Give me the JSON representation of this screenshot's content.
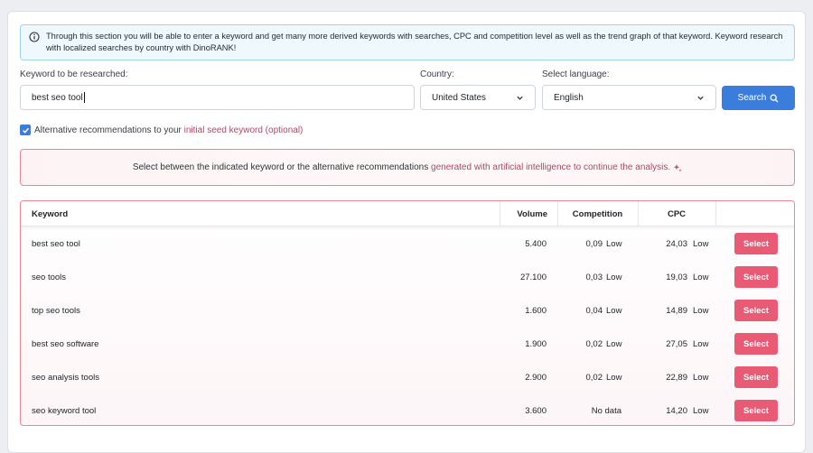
{
  "info": {
    "text": "Through this section you will be able to enter a keyword and get many more derived keywords with searches, CPC and competition level as well as the trend graph of that keyword. Keyword research with localized searches by country with DinoRANK!",
    "icon": "info-circle-icon"
  },
  "form": {
    "keyword_label": "Keyword to be researched:",
    "keyword_value": "best seo tool",
    "country_label": "Country:",
    "country_value": "United States",
    "language_label": "Select language:",
    "language_value": "English",
    "search_label": "Search",
    "search_icon": "magnifier-icon"
  },
  "alt": {
    "checked": true,
    "prefix": "Alternative recommendations to your ",
    "highlight": "initial seed keyword (optional)"
  },
  "notice": {
    "prefix": "Select between the indicated keyword or the alternative recommendations ",
    "highlight": "generated with artificial intelligence to continue the analysis.",
    "icon": "sparkle-icon"
  },
  "table": {
    "headers": {
      "keyword": "Keyword",
      "volume": "Volume",
      "competition": "Competition",
      "cpc": "CPC"
    },
    "rows": [
      {
        "keyword": "best seo tool",
        "volume": "5.400",
        "comp_value": "0,09",
        "comp_level": "Low",
        "cpc": "24,03",
        "cpc_level": "Low",
        "action": "Select"
      },
      {
        "keyword": "seo tools",
        "volume": "27.100",
        "comp_value": "0,03",
        "comp_level": "Low",
        "cpc": "19,03",
        "cpc_level": "Low",
        "action": "Select"
      },
      {
        "keyword": "top seo tools",
        "volume": "1.600",
        "comp_value": "0,04",
        "comp_level": "Low",
        "cpc": "14,89",
        "cpc_level": "Low",
        "action": "Select"
      },
      {
        "keyword": "best seo software",
        "volume": "1.900",
        "comp_value": "0,02",
        "comp_level": "Low",
        "cpc": "27,05",
        "cpc_level": "Low",
        "action": "Select"
      },
      {
        "keyword": "seo analysis tools",
        "volume": "2.900",
        "comp_value": "0,02",
        "comp_level": "Low",
        "cpc": "22,89",
        "cpc_level": "Low",
        "action": "Select"
      },
      {
        "keyword": "seo keyword tool",
        "volume": "3.600",
        "comp_value": "No data",
        "comp_level": "",
        "cpc": "14,20",
        "cpc_level": "Low",
        "action": "Select"
      }
    ]
  },
  "colors": {
    "accent_blue": "#3b7ddd",
    "select_pink": "#e95a75",
    "highlight_text": "#b24662",
    "border_pink": "#ee8595",
    "info_border": "#9fd4ef"
  }
}
